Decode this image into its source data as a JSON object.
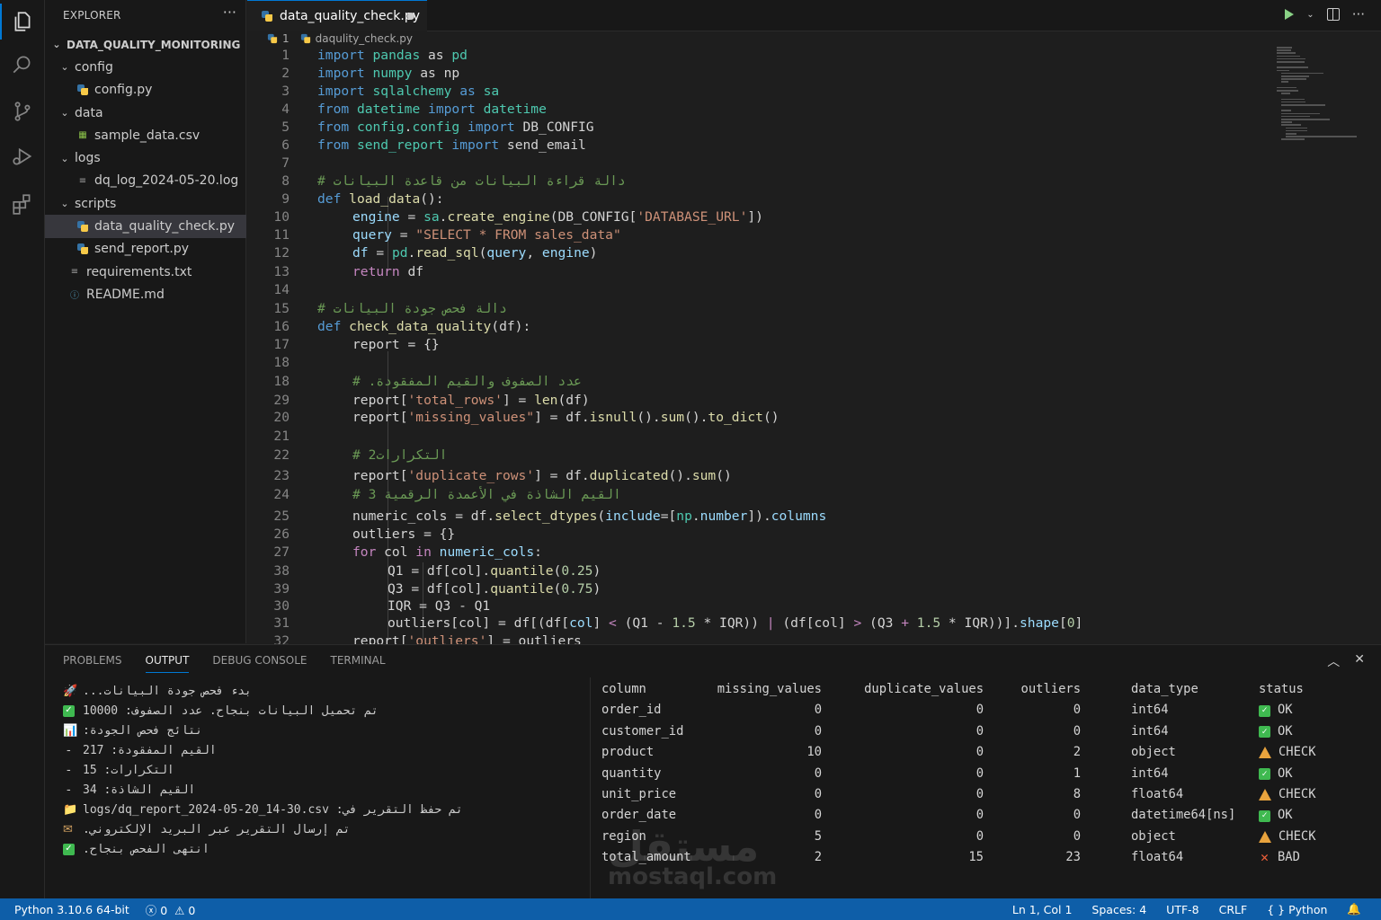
{
  "explorer": {
    "title": "EXPLORER",
    "more": "···",
    "tree": [
      {
        "label": "DATA_QUALITY_MONITORING",
        "kind": "root",
        "depth": 0,
        "chevron": "⌄"
      },
      {
        "label": "config",
        "kind": "folder",
        "depth": 1,
        "chevron": "⌄"
      },
      {
        "label": "config.py",
        "kind": "py",
        "depth": 2
      },
      {
        "label": "data",
        "kind": "folder",
        "depth": 1,
        "chevron": "⌄"
      },
      {
        "label": "sample_data.csv",
        "kind": "csv",
        "depth": 2
      },
      {
        "label": "logs",
        "kind": "folder",
        "depth": 1,
        "chevron": "⌄"
      },
      {
        "label": "dq_log_2024-05-20.log",
        "kind": "log",
        "depth": 2
      },
      {
        "label": "scripts",
        "kind": "folder",
        "depth": 1,
        "chevron": "⌄"
      },
      {
        "label": "data_quality_check.py",
        "kind": "py",
        "depth": 2,
        "selected": true
      },
      {
        "label": "send_report.py",
        "kind": "py",
        "depth": 2
      },
      {
        "label": "requirements.txt",
        "kind": "txt",
        "depth": 1
      },
      {
        "label": "README.md",
        "kind": "md",
        "depth": 1
      }
    ]
  },
  "editor": {
    "tab_label": "data_quality_check.py",
    "breadcrumb_num": "1",
    "breadcrumb_file": "daqulity_check.py",
    "lines": [
      {
        "n": "1",
        "indent": 0,
        "tokens": [
          [
            "kd",
            "import"
          ],
          [
            "plain",
            " "
          ],
          [
            "mod",
            "pandas"
          ],
          [
            "plain",
            " as "
          ],
          [
            "mod",
            "pd"
          ]
        ]
      },
      {
        "n": "2",
        "indent": 0,
        "tokens": [
          [
            "kd",
            "import"
          ],
          [
            "plain",
            " "
          ],
          [
            "mod",
            "numpy"
          ],
          [
            "plain",
            " as np"
          ]
        ]
      },
      {
        "n": "3",
        "indent": 0,
        "tokens": [
          [
            "kd",
            "import"
          ],
          [
            "plain",
            " "
          ],
          [
            "mod",
            "sqlalchemy"
          ],
          [
            "plain",
            " "
          ],
          [
            "kd",
            "as"
          ],
          [
            "plain",
            " "
          ],
          [
            "mod",
            "sa"
          ]
        ]
      },
      {
        "n": "4",
        "indent": 0,
        "tokens": [
          [
            "kd",
            "from"
          ],
          [
            "plain",
            " "
          ],
          [
            "mod",
            "datetime"
          ],
          [
            "plain",
            " "
          ],
          [
            "kd",
            "import"
          ],
          [
            "plain",
            " "
          ],
          [
            "mod",
            "datetime"
          ]
        ]
      },
      {
        "n": "5",
        "indent": 0,
        "tokens": [
          [
            "kd",
            "from"
          ],
          [
            "plain",
            " "
          ],
          [
            "mod",
            "config"
          ],
          [
            "plain",
            "."
          ],
          [
            "mod",
            "config"
          ],
          [
            "plain",
            " "
          ],
          [
            "kd",
            "import"
          ],
          [
            "plain",
            " DB_CONFIG"
          ]
        ]
      },
      {
        "n": "6",
        "indent": 0,
        "tokens": [
          [
            "kd",
            "from"
          ],
          [
            "plain",
            " "
          ],
          [
            "mod",
            "send_report"
          ],
          [
            "plain",
            " "
          ],
          [
            "kd",
            "import"
          ],
          [
            "plain",
            " send_email"
          ]
        ]
      },
      {
        "n": "7",
        "indent": 0,
        "tokens": []
      },
      {
        "n": "8",
        "indent": 0,
        "tokens": [
          [
            "cm",
            "# دالة قراءة البيانات من قاعدة البيانات"
          ]
        ]
      },
      {
        "n": "9",
        "indent": 0,
        "tokens": [
          [
            "kd",
            "def"
          ],
          [
            "plain",
            " "
          ],
          [
            "fn",
            "load_data"
          ],
          [
            "plain",
            "():"
          ]
        ]
      },
      {
        "n": "10",
        "indent": 1,
        "tokens": [
          [
            "var",
            "engine"
          ],
          [
            "plain",
            " = "
          ],
          [
            "mod",
            "sa"
          ],
          [
            "plain",
            "."
          ],
          [
            "fn",
            "create_engine"
          ],
          [
            "plain",
            "(DB_CONFIG["
          ],
          [
            "str",
            "'DATABASE_URL'"
          ],
          [
            "plain",
            "])"
          ]
        ]
      },
      {
        "n": "11",
        "indent": 1,
        "tokens": [
          [
            "var",
            "query"
          ],
          [
            "plain",
            " = "
          ],
          [
            "str",
            "\"SELECT * FROM sales_data\""
          ]
        ]
      },
      {
        "n": "12",
        "indent": 1,
        "tokens": [
          [
            "var",
            "df"
          ],
          [
            "plain",
            " = "
          ],
          [
            "mod",
            "pd"
          ],
          [
            "plain",
            "."
          ],
          [
            "fn",
            "read_sql"
          ],
          [
            "plain",
            "("
          ],
          [
            "var",
            "query"
          ],
          [
            "plain",
            ", "
          ],
          [
            "var",
            "engine"
          ],
          [
            "plain",
            ")"
          ]
        ]
      },
      {
        "n": "13",
        "indent": 1,
        "tokens": [
          [
            "kw",
            "return"
          ],
          [
            "plain",
            " df"
          ]
        ]
      },
      {
        "n": "14",
        "indent": 0,
        "tokens": []
      },
      {
        "n": "15",
        "indent": 0,
        "tokens": [
          [
            "cm",
            "# دالة فحص جودة البيانات"
          ]
        ]
      },
      {
        "n": "16",
        "indent": 0,
        "tokens": [
          [
            "kd",
            "def"
          ],
          [
            "plain",
            " "
          ],
          [
            "fn",
            "check_data_quality"
          ],
          [
            "plain",
            "(df):"
          ]
        ]
      },
      {
        "n": "17",
        "indent": 1,
        "tokens": [
          [
            "plain",
            "report = {}"
          ]
        ]
      },
      {
        "n": "18",
        "indent": 0,
        "tokens": []
      },
      {
        "n": "18",
        "indent": 1,
        "tokens": [
          [
            "cm",
            "# .عدد الصفوف والقيم المفقودة"
          ]
        ]
      },
      {
        "n": "29",
        "indent": 1,
        "tokens": [
          [
            "plain",
            "report["
          ],
          [
            "str",
            "'total_rows'"
          ],
          [
            "plain",
            "] = "
          ],
          [
            "fn",
            "len"
          ],
          [
            "plain",
            "(df)"
          ]
        ]
      },
      {
        "n": "20",
        "indent": 1,
        "tokens": [
          [
            "plain",
            "report["
          ],
          [
            "str",
            "'missing_values\""
          ],
          [
            "plain",
            "] = df."
          ],
          [
            "fn",
            "isnull"
          ],
          [
            "plain",
            "()."
          ],
          [
            "fn",
            "sum"
          ],
          [
            "plain",
            "()."
          ],
          [
            "fn",
            "to_dict"
          ],
          [
            "plain",
            "()"
          ]
        ]
      },
      {
        "n": "21",
        "indent": 0,
        "tokens": []
      },
      {
        "n": "22",
        "indent": 1,
        "tokens": [
          [
            "cm",
            "# 2التكرارات"
          ]
        ]
      },
      {
        "n": "23",
        "indent": 1,
        "tokens": [
          [
            "plain",
            "report["
          ],
          [
            "str",
            "'duplicate_rows'"
          ],
          [
            "plain",
            "] = df."
          ],
          [
            "fn",
            "duplicated"
          ],
          [
            "plain",
            "()."
          ],
          [
            "fn",
            "sum"
          ],
          [
            "plain",
            "()"
          ]
        ]
      },
      {
        "n": "24",
        "indent": 1,
        "tokens": [
          [
            "cm",
            "# 3 القيم الشاذة في الأعمدة الرقمية"
          ]
        ]
      },
      {
        "n": "25",
        "indent": 1,
        "tokens": [
          [
            "plain",
            "numeric_cols = df."
          ],
          [
            "fn",
            "select_dtypes"
          ],
          [
            "plain",
            "("
          ],
          [
            "var",
            "include"
          ],
          [
            "plain",
            "=["
          ],
          [
            "mod",
            "np"
          ],
          [
            "plain",
            "."
          ],
          [
            "var",
            "number"
          ],
          [
            "plain",
            "])."
          ],
          [
            "var",
            "columns"
          ]
        ]
      },
      {
        "n": "26",
        "indent": 1,
        "tokens": [
          [
            "plain",
            "outliers = {}"
          ]
        ]
      },
      {
        "n": "27",
        "indent": 1,
        "tokens": [
          [
            "kw",
            "for"
          ],
          [
            "plain",
            " col "
          ],
          [
            "kw",
            "in"
          ],
          [
            "plain",
            " "
          ],
          [
            "var",
            "numeric_cols"
          ],
          [
            "plain",
            ":"
          ]
        ]
      },
      {
        "n": "38",
        "indent": 2,
        "tokens": [
          [
            "plain",
            "Q1 = df[col]."
          ],
          [
            "fn",
            "quantile"
          ],
          [
            "plain",
            "("
          ],
          [
            "num",
            "0.25"
          ],
          [
            "plain",
            ")"
          ]
        ]
      },
      {
        "n": "39",
        "indent": 2,
        "tokens": [
          [
            "plain",
            "Q3 = df[col]."
          ],
          [
            "fn",
            "quantile"
          ],
          [
            "plain",
            "("
          ],
          [
            "num",
            "0.75"
          ],
          [
            "plain",
            ")"
          ]
        ]
      },
      {
        "n": "30",
        "indent": 2,
        "tokens": [
          [
            "plain",
            "IQR = Q3 - Q1"
          ]
        ]
      },
      {
        "n": "31",
        "indent": 2,
        "tokens": [
          [
            "plain",
            "outliers[col] = df[(df["
          ],
          [
            "var",
            "col"
          ],
          [
            "plain",
            "] "
          ],
          [
            "kw",
            "<"
          ],
          [
            "plain",
            " (Q1 - "
          ],
          [
            "num",
            "1.5"
          ],
          [
            "plain",
            " * IQR)) "
          ],
          [
            "kw",
            "|"
          ],
          [
            "plain",
            " (df[col] "
          ],
          [
            "kw",
            ">"
          ],
          [
            "plain",
            " (Q3 "
          ],
          [
            "kw",
            "+"
          ],
          [
            "plain",
            " "
          ],
          [
            "num",
            "1.5"
          ],
          [
            "plain",
            " * IQR))]."
          ],
          [
            "var",
            "shape"
          ],
          [
            "plain",
            "["
          ],
          [
            "num",
            "0"
          ],
          [
            "plain",
            "]"
          ]
        ]
      },
      {
        "n": "32",
        "indent": 1,
        "tokens": [
          [
            "plain",
            "report["
          ],
          [
            "str",
            "'outliers'"
          ],
          [
            "plain",
            "] = outliers"
          ]
        ]
      }
    ]
  },
  "panel": {
    "tabs": [
      "PROBLEMS",
      "OUTPUT",
      "DEBUG CONSOLE",
      "TERMINAL"
    ],
    "active_tab": "OUTPUT",
    "output_lines": [
      {
        "icon": "rocket",
        "glyph": "🚀",
        "text": "بدء فحص جودة البيانات..."
      },
      {
        "icon": "check",
        "glyph": "✓",
        "text": "تم تحميل البيانات بنجاح. عدد الصفوف: 10000"
      },
      {
        "icon": "chart",
        "glyph": "📊",
        "text": "نتائج فحص الجودة:"
      },
      {
        "icon": "dash",
        "glyph": "-",
        "text": "القيم المفقودة: 217"
      },
      {
        "icon": "dash",
        "glyph": "-",
        "text": "التكرارات: 15"
      },
      {
        "icon": "dash",
        "glyph": "-",
        "text": "القيم الشاذة: 34"
      },
      {
        "icon": "folder",
        "glyph": "📁",
        "text": "تم حفظ التقرير في: logs/dq_report_2024-05-20_14-30.csv"
      },
      {
        "icon": "mail",
        "glyph": "✉",
        "text": "تم إرسال التقرير عبر البريد الإلكتروني."
      },
      {
        "icon": "check",
        "glyph": "✓",
        "text": "انتهى الفحص بنجاح."
      }
    ],
    "table": {
      "headers": [
        "column",
        "missing_values",
        "duplicate_values",
        "outliers",
        "data_type",
        "status"
      ],
      "rows": [
        {
          "column": "order_id",
          "missing": "0",
          "dup": "0",
          "outliers": "0",
          "type": "int64",
          "status": "OK",
          "kind": "ok"
        },
        {
          "column": "customer_id",
          "missing": "0",
          "dup": "0",
          "outliers": "0",
          "type": "int64",
          "status": "OK",
          "kind": "ok"
        },
        {
          "column": "product",
          "missing": "10",
          "dup": "0",
          "outliers": "2",
          "type": "object",
          "status": "CHECK",
          "kind": "warn"
        },
        {
          "column": "quantity",
          "missing": "0",
          "dup": "0",
          "outliers": "1",
          "type": "int64",
          "status": "OK",
          "kind": "ok"
        },
        {
          "column": "unit_price",
          "missing": "0",
          "dup": "0",
          "outliers": "8",
          "type": "float64",
          "status": "CHECK",
          "kind": "warn"
        },
        {
          "column": "order_date",
          "missing": "0",
          "dup": "0",
          "outliers": "0",
          "type": "datetime64[ns]",
          "status": "OK",
          "kind": "ok"
        },
        {
          "column": "region",
          "missing": "5",
          "dup": "0",
          "outliers": "0",
          "type": "object",
          "status": "CHECK",
          "kind": "warn"
        },
        {
          "column": "total_amount",
          "missing": "2",
          "dup": "15",
          "outliers": "23",
          "type": "float64",
          "status": "BAD",
          "kind": "bad"
        }
      ]
    }
  },
  "watermark": {
    "arabic": "مستقل",
    "latin": "mostaql.com"
  },
  "statusbar": {
    "python": "Python 3.10.6 64-bit",
    "errors": "0",
    "warnings": "0",
    "position": "Ln 1, Col 1",
    "spaces": "Spaces: 4",
    "encoding": "UTF-8",
    "eol": "CRLF",
    "language": "Python"
  },
  "colors": {
    "accent": "#0078d4",
    "statusbar": "#0e5ea8",
    "ok": "#3fb950",
    "warn": "#e8a33d",
    "bad": "#f0603a"
  }
}
